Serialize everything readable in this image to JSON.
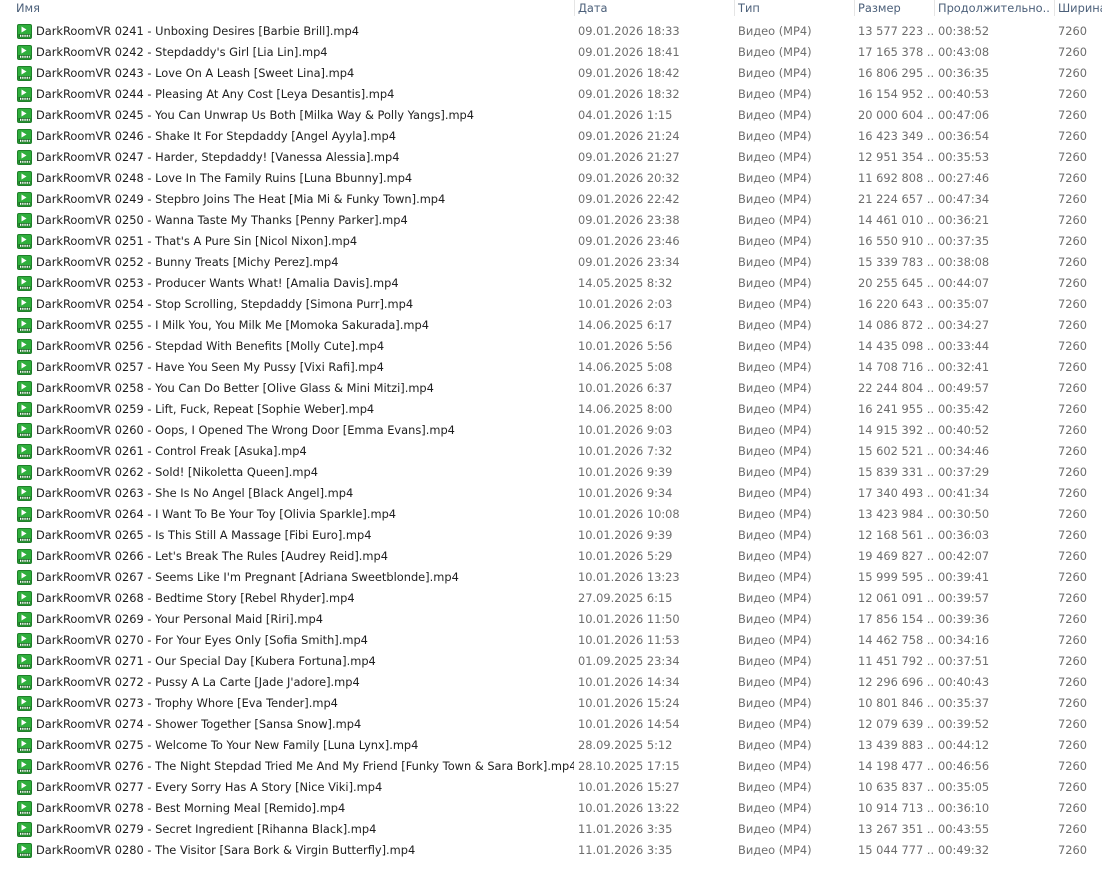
{
  "columns": {
    "name": "Имя",
    "date": "Дата",
    "type": "Тип",
    "size": "Размер",
    "duration": "Продолжительно...",
    "width": "Ширина"
  },
  "accent_color": "#2fae3c",
  "file_icon": "mp4-video-file-icon",
  "rows": [
    {
      "name": "DarkRoomVR 0241 - Unboxing Desires [Barbie Brill].mp4",
      "date": "09.01.2026 18:33",
      "type": "Видео (MP4)",
      "size": "13 577 223 ...",
      "duration": "00:38:52",
      "width": "7260"
    },
    {
      "name": "DarkRoomVR 0242 - Stepdaddy's Girl [Lia Lin].mp4",
      "date": "09.01.2026 18:41",
      "type": "Видео (MP4)",
      "size": "17 165 378 ...",
      "duration": "00:43:08",
      "width": "7260"
    },
    {
      "name": "DarkRoomVR 0243 - Love On A Leash [Sweet Lina].mp4",
      "date": "09.01.2026 18:42",
      "type": "Видео (MP4)",
      "size": "16 806 295 ...",
      "duration": "00:36:35",
      "width": "7260"
    },
    {
      "name": "DarkRoomVR 0244 - Pleasing At Any Cost [Leya Desantis].mp4",
      "date": "09.01.2026 18:32",
      "type": "Видео (MP4)",
      "size": "16 154 952 ...",
      "duration": "00:40:53",
      "width": "7260"
    },
    {
      "name": "DarkRoomVR 0245 - You Can Unwrap Us Both [Milka Way & Polly Yangs].mp4",
      "date": "04.01.2026 1:15",
      "type": "Видео (MP4)",
      "size": "20 000 604 ...",
      "duration": "00:47:06",
      "width": "7260"
    },
    {
      "name": "DarkRoomVR 0246 - Shake It For Stepdaddy [Angel Ayyla].mp4",
      "date": "09.01.2026 21:24",
      "type": "Видео (MP4)",
      "size": "16 423 349 ...",
      "duration": "00:36:54",
      "width": "7260"
    },
    {
      "name": "DarkRoomVR 0247 - Harder, Stepdaddy! [Vanessa Alessia].mp4",
      "date": "09.01.2026 21:27",
      "type": "Видео (MP4)",
      "size": "12 951 354 ...",
      "duration": "00:35:53",
      "width": "7260"
    },
    {
      "name": "DarkRoomVR 0248 - Love In The Family Ruins [Luna Bbunny].mp4",
      "date": "09.01.2026 20:32",
      "type": "Видео (MP4)",
      "size": "11 692 808 ...",
      "duration": "00:27:46",
      "width": "7260"
    },
    {
      "name": "DarkRoomVR 0249 - Stepbro Joins The Heat [Mia Mi & Funky Town].mp4",
      "date": "09.01.2026 22:42",
      "type": "Видео (MP4)",
      "size": "21 224 657 ...",
      "duration": "00:47:34",
      "width": "7260"
    },
    {
      "name": "DarkRoomVR 0250 - Wanna Taste My Thanks [Penny Parker].mp4",
      "date": "09.01.2026 23:38",
      "type": "Видео (MP4)",
      "size": "14 461 010 ...",
      "duration": "00:36:21",
      "width": "7260"
    },
    {
      "name": "DarkRoomVR 0251 - That's A Pure Sin [Nicol Nixon].mp4",
      "date": "09.01.2026 23:46",
      "type": "Видео (MP4)",
      "size": "16 550 910 ...",
      "duration": "00:37:35",
      "width": "7260"
    },
    {
      "name": "DarkRoomVR 0252 - Bunny Treats [Michy Perez].mp4",
      "date": "09.01.2026 23:34",
      "type": "Видео (MP4)",
      "size": "15 339 783 ...",
      "duration": "00:38:08",
      "width": "7260"
    },
    {
      "name": "DarkRoomVR 0253 - Producer Wants What! [Amalia Davis].mp4",
      "date": "14.05.2025 8:32",
      "type": "Видео (MP4)",
      "size": "20 255 645 ...",
      "duration": "00:44:07",
      "width": "7260"
    },
    {
      "name": "DarkRoomVR 0254 - Stop Scrolling, Stepdaddy [Simona Purr].mp4",
      "date": "10.01.2026 2:03",
      "type": "Видео (MP4)",
      "size": "16 220 643 ...",
      "duration": "00:35:07",
      "width": "7260"
    },
    {
      "name": "DarkRoomVR 0255 - I Milk You, You Milk Me [Momoka Sakurada].mp4",
      "date": "14.06.2025 6:17",
      "type": "Видео (MP4)",
      "size": "14 086 872 ...",
      "duration": "00:34:27",
      "width": "7260"
    },
    {
      "name": "DarkRoomVR 0256 - Stepdad With Benefits [Molly Cute].mp4",
      "date": "10.01.2026 5:56",
      "type": "Видео (MP4)",
      "size": "14 435 098 ...",
      "duration": "00:33:44",
      "width": "7260"
    },
    {
      "name": "DarkRoomVR 0257 - Have You Seen My Pussy [Vixi Rafi].mp4",
      "date": "14.06.2025 5:08",
      "type": "Видео (MP4)",
      "size": "14 708 716 ...",
      "duration": "00:32:41",
      "width": "7260"
    },
    {
      "name": "DarkRoomVR 0258 - You Can Do Better [Olive Glass & Mini Mitzi].mp4",
      "date": "10.01.2026 6:37",
      "type": "Видео (MP4)",
      "size": "22 244 804 ...",
      "duration": "00:49:57",
      "width": "7260"
    },
    {
      "name": "DarkRoomVR 0259 - Lift, Fuck, Repeat [Sophie Weber].mp4",
      "date": "14.06.2025 8:00",
      "type": "Видео (MP4)",
      "size": "16 241 955 ...",
      "duration": "00:35:42",
      "width": "7260"
    },
    {
      "name": "DarkRoomVR 0260 - Oops, I Opened The Wrong Door [Emma Evans].mp4",
      "date": "10.01.2026 9:03",
      "type": "Видео (MP4)",
      "size": "14 915 392 ...",
      "duration": "00:40:52",
      "width": "7260"
    },
    {
      "name": "DarkRoomVR 0261 - Control Freak [Asuka].mp4",
      "date": "10.01.2026 7:32",
      "type": "Видео (MP4)",
      "size": "15 602 521 ...",
      "duration": "00:34:46",
      "width": "7260"
    },
    {
      "name": "DarkRoomVR 0262 - Sold! [Nikoletta Queen].mp4",
      "date": "10.01.2026 9:39",
      "type": "Видео (MP4)",
      "size": "15 839 331 ...",
      "duration": "00:37:29",
      "width": "7260"
    },
    {
      "name": "DarkRoomVR 0263 - She Is No Angel [Black Angel].mp4",
      "date": "10.01.2026 9:34",
      "type": "Видео (MP4)",
      "size": "17 340 493 ...",
      "duration": "00:41:34",
      "width": "7260"
    },
    {
      "name": "DarkRoomVR 0264 - I Want To Be Your Toy [Olivia Sparkle].mp4",
      "date": "10.01.2026 10:08",
      "type": "Видео (MP4)",
      "size": "13 423 984 ...",
      "duration": "00:30:50",
      "width": "7260"
    },
    {
      "name": "DarkRoomVR 0265 - Is This Still A Massage [Fibi Euro].mp4",
      "date": "10.01.2026 9:39",
      "type": "Видео (MP4)",
      "size": "12 168 561 ...",
      "duration": "00:36:03",
      "width": "7260"
    },
    {
      "name": "DarkRoomVR 0266 - Let's Break The Rules [Audrey Reid].mp4",
      "date": "10.01.2026 5:29",
      "type": "Видео (MP4)",
      "size": "19 469 827 ...",
      "duration": "00:42:07",
      "width": "7260"
    },
    {
      "name": "DarkRoomVR 0267 - Seems Like I'm Pregnant [Adriana Sweetblonde].mp4",
      "date": "10.01.2026 13:23",
      "type": "Видео (MP4)",
      "size": "15 999 595 ...",
      "duration": "00:39:41",
      "width": "7260"
    },
    {
      "name": "DarkRoomVR 0268 - Bedtime Story [Rebel Rhyder].mp4",
      "date": "27.09.2025 6:15",
      "type": "Видео (MP4)",
      "size": "12 061 091 ...",
      "duration": "00:39:57",
      "width": "7260"
    },
    {
      "name": "DarkRoomVR 0269 - Your Personal Maid [Riri].mp4",
      "date": "10.01.2026 11:50",
      "type": "Видео (MP4)",
      "size": "17 856 154 ...",
      "duration": "00:39:36",
      "width": "7260"
    },
    {
      "name": "DarkRoomVR 0270 - For Your Eyes Only [Sofia Smith].mp4",
      "date": "10.01.2026 11:53",
      "type": "Видео (MP4)",
      "size": "14 462 758 ...",
      "duration": "00:34:16",
      "width": "7260"
    },
    {
      "name": "DarkRoomVR 0271 - Our Special Day [Kubera Fortuna].mp4",
      "date": "01.09.2025 23:34",
      "type": "Видео (MP4)",
      "size": "11 451 792 ...",
      "duration": "00:37:51",
      "width": "7260"
    },
    {
      "name": "DarkRoomVR 0272 - Pussy A La Carte [Jade J'adore].mp4",
      "date": "10.01.2026 14:34",
      "type": "Видео (MP4)",
      "size": "12 296 696 ...",
      "duration": "00:40:43",
      "width": "7260"
    },
    {
      "name": "DarkRoomVR 0273 - Trophy Whore [Eva Tender].mp4",
      "date": "10.01.2026 15:24",
      "type": "Видео (MP4)",
      "size": "10 801 846 ...",
      "duration": "00:35:37",
      "width": "7260"
    },
    {
      "name": "DarkRoomVR 0274 - Shower Together [Sansa Snow].mp4",
      "date": "10.01.2026 14:54",
      "type": "Видео (MP4)",
      "size": "12 079 639 ...",
      "duration": "00:39:52",
      "width": "7260"
    },
    {
      "name": "DarkRoomVR 0275 - Welcome To Your New Family [Luna Lynx].mp4",
      "date": "28.09.2025 5:12",
      "type": "Видео (MP4)",
      "size": "13 439 883 ...",
      "duration": "00:44:12",
      "width": "7260"
    },
    {
      "name": "DarkRoomVR 0276 - The Night Stepdad Tried Me And My Friend [Funky Town & Sara Bork].mp4",
      "date": "28.10.2025 17:15",
      "type": "Видео (MP4)",
      "size": "14 198 477 ...",
      "duration": "00:46:56",
      "width": "7260"
    },
    {
      "name": "DarkRoomVR 0277 - Every Sorry Has A Story [Nice Viki].mp4",
      "date": "10.01.2026 15:27",
      "type": "Видео (MP4)",
      "size": "10 635 837 ...",
      "duration": "00:35:05",
      "width": "7260"
    },
    {
      "name": "DarkRoomVR 0278 - Best Morning Meal [Remido].mp4",
      "date": "10.01.2026 13:22",
      "type": "Видео (MP4)",
      "size": "10 914 713 ...",
      "duration": "00:36:10",
      "width": "7260"
    },
    {
      "name": "DarkRoomVR 0279 - Secret Ingredient [Rihanna Black].mp4",
      "date": "11.01.2026 3:35",
      "type": "Видео (MP4)",
      "size": "13 267 351 ...",
      "duration": "00:43:55",
      "width": "7260"
    },
    {
      "name": "DarkRoomVR 0280 - The Visitor [Sara Bork & Virgin Butterfly].mp4",
      "date": "11.01.2026 3:35",
      "type": "Видео (MP4)",
      "size": "15 044 777 ...",
      "duration": "00:49:32",
      "width": "7260"
    }
  ]
}
